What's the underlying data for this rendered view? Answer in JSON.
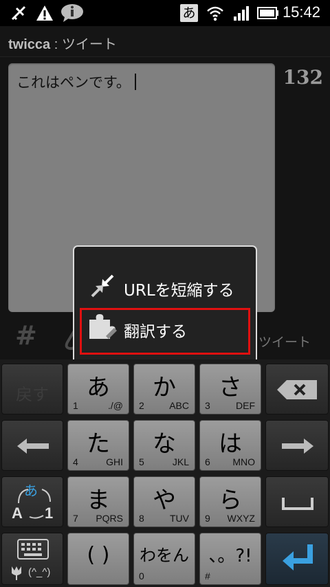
{
  "status_bar": {
    "time": "15:42",
    "ime_indicator": "あ"
  },
  "app_bar": {
    "app_name": "twicca",
    "separator": " : ",
    "screen": "ツイート"
  },
  "compose": {
    "text": "これはペンです。",
    "remaining_chars": "132"
  },
  "toolbar": {
    "hashtag_label": "#",
    "tweet_label": "ツイート"
  },
  "popup_menu": {
    "items": [
      {
        "label": "URLを短縮する",
        "icon": "shrink-arrows-icon"
      },
      {
        "label": "翻訳する",
        "icon": "puzzle-piece-icon",
        "highlighted": true
      }
    ],
    "highlight_color": "#e01010"
  },
  "keyboard": {
    "undo_label": "戻す",
    "keys": [
      {
        "main": "あ",
        "num": "1",
        "sub": "./@"
      },
      {
        "main": "か",
        "num": "2",
        "sub": "ABC"
      },
      {
        "main": "さ",
        "num": "3",
        "sub": "DEF"
      },
      {
        "main": "た",
        "num": "4",
        "sub": "GHI"
      },
      {
        "main": "な",
        "num": "5",
        "sub": "JKL"
      },
      {
        "main": "は",
        "num": "6",
        "sub": "MNO"
      },
      {
        "main": "ま",
        "num": "7",
        "sub": "PQRS"
      },
      {
        "main": "や",
        "num": "8",
        "sub": "TUV"
      },
      {
        "main": "ら",
        "num": "9",
        "sub": "WXYZ"
      },
      {
        "main": "( )",
        "num": "",
        "sub": ""
      },
      {
        "main": "わをん",
        "num": "0",
        "sub": ""
      },
      {
        "main": "、。?!",
        "num": "#",
        "sub": ""
      }
    ],
    "mode_labels": {
      "hiragana": "あ",
      "alpha": "A",
      "one": "1",
      "emoji": "(^_^)"
    }
  },
  "colors": {
    "accent": "#e01010",
    "ime_blue": "#3aa0e0"
  }
}
